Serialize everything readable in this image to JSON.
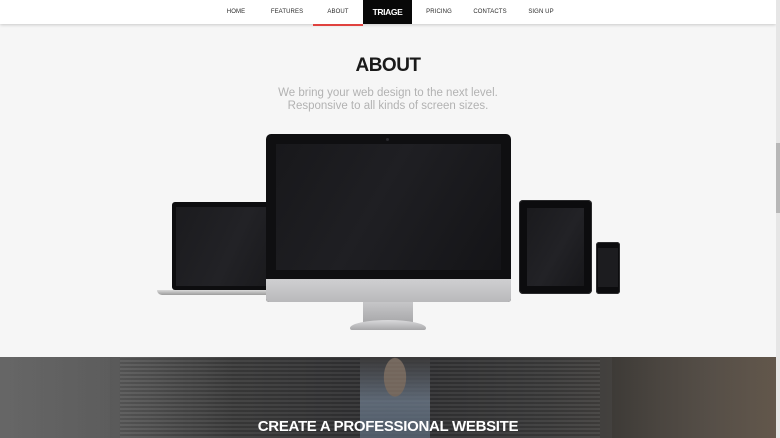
{
  "navbar": {
    "items": [
      {
        "label": "HOME"
      },
      {
        "label": "FEATURES"
      },
      {
        "label": "ABOUT"
      },
      {
        "label": "PRICING"
      },
      {
        "label": "CONTACTS"
      },
      {
        "label": "SIGN UP"
      }
    ],
    "brand": "TRIAGE",
    "active_item": "ABOUT",
    "accent_color": "#e0423f"
  },
  "about": {
    "title": "ABOUT",
    "subtitle_line1": "We bring your web design to the next level.",
    "subtitle_line2": "Responsive to all kinds of screen sizes."
  },
  "hero": {
    "title": "CREATE A PROFESSIONAL WEBSITE"
  }
}
